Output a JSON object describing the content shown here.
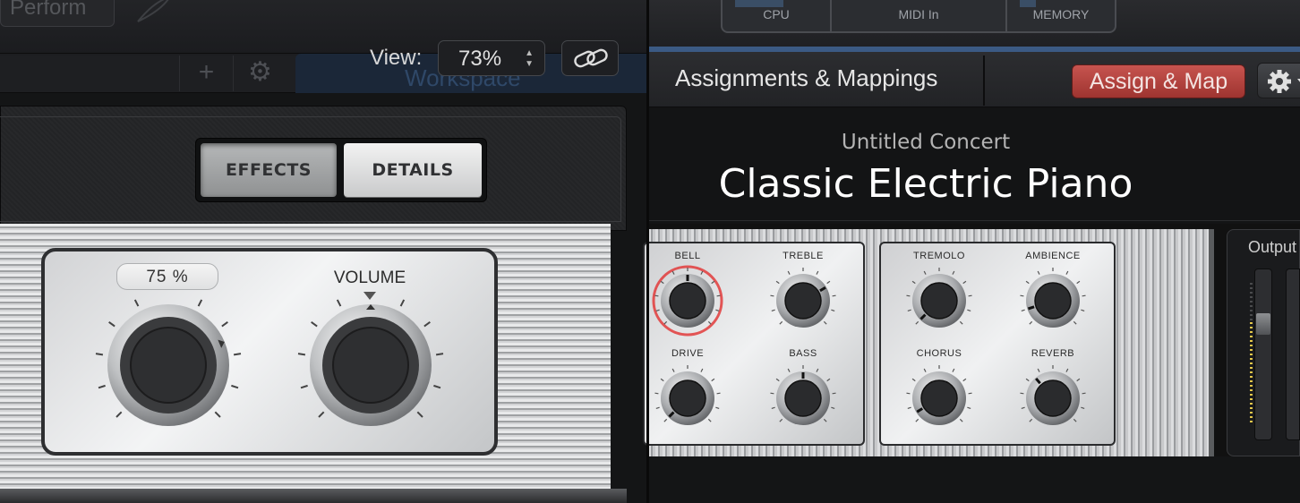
{
  "top": {
    "perform_label": "Perform",
    "view_label": "View:",
    "zoom_value": "73%",
    "workspace_tab": "Workspace"
  },
  "toolbar": {
    "add_symbol": "+",
    "gear_symbol": "⚙"
  },
  "plugin": {
    "tabs": [
      {
        "label": "EFFECTS",
        "selected": false
      },
      {
        "label": "DETAILS",
        "selected": true
      }
    ],
    "knobs": [
      {
        "label": "75 %",
        "value": 0.75
      },
      {
        "label": "VOLUME",
        "value": 0.5
      }
    ]
  },
  "meters": [
    {
      "label": "CPU",
      "fill": 0.6
    },
    {
      "label": "MIDI In",
      "fill": 0.0
    },
    {
      "label": "MEMORY",
      "fill": 0.2
    }
  ],
  "header": {
    "title": "Assignments & Mappings",
    "assign_button": "Assign & Map"
  },
  "concert": {
    "name": "Untitled Concert",
    "patch": "Classic Electric Piano"
  },
  "smart_controls": [
    {
      "label": "BELL",
      "value": 0.5,
      "selected": true
    },
    {
      "label": "TREBLE",
      "value": 0.72,
      "selected": false
    },
    {
      "label": "DRIVE",
      "value": 0.0,
      "selected": false
    },
    {
      "label": "BASS",
      "value": 0.5,
      "selected": false
    },
    {
      "label": "TREMOLO",
      "value": 0.0,
      "selected": false
    },
    {
      "label": "AMBIENCE",
      "value": 0.1,
      "selected": false
    },
    {
      "label": "CHORUS",
      "value": 0.05,
      "selected": false
    },
    {
      "label": "REVERB",
      "value": 0.35,
      "selected": false
    }
  ],
  "output": {
    "label": "Output",
    "fader_level": 0.7,
    "meter_level": 0.72
  },
  "colors": {
    "assign_red": "#b4443f",
    "selection_glow": "#e23b3b",
    "workspace_blue": "#3b5a84",
    "meter_yellow": "#e5c84b"
  }
}
